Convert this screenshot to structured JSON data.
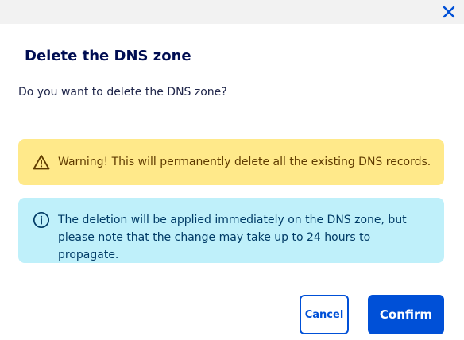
{
  "dialog": {
    "title": "Delete the DNS zone",
    "question": "Do you want to delete the DNS zone?",
    "close_icon": "close-icon"
  },
  "warning": {
    "icon": "warning-triangle-icon",
    "text": "Warning! This will permanently delete all the existing DNS records."
  },
  "info": {
    "icon": "info-circle-icon",
    "text": "The deletion will be applied immediately on the DNS zone, but please note that the change may take up to 24 hours to propagate."
  },
  "actions": {
    "cancel_label": "Cancel",
    "confirm_label": "Confirm"
  },
  "colors": {
    "primary": "#0050d7",
    "title": "#000d52",
    "warning_bg": "#ffe98a",
    "warning_text": "#5f3b00",
    "info_bg": "#bff0fa",
    "info_text": "#003b66"
  }
}
